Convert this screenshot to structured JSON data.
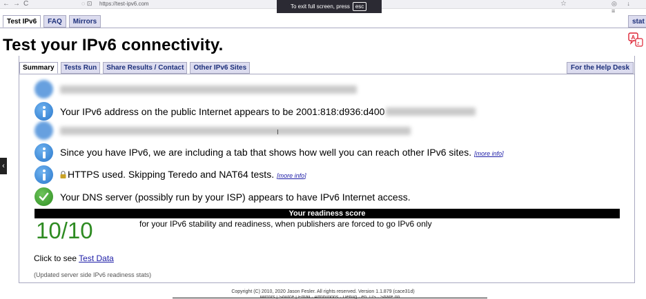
{
  "browser": {
    "url": "https://test-ipv6.com",
    "nav_glyphs": "←→C",
    "url_icons": "◌ ⊡",
    "star_glyph": "☆",
    "right_glyphs": "◎ ↓ ≡"
  },
  "fullscreen_toast": {
    "text": "To exit full screen, press",
    "key": "esc"
  },
  "top_tabs": [
    {
      "label": "Test IPv6",
      "active": true
    },
    {
      "label": "FAQ",
      "active": false
    },
    {
      "label": "Mirrors",
      "active": false
    }
  ],
  "top_tab_right": "stat",
  "page_title": "Test your IPv6 connectivity.",
  "sub_tabs": [
    {
      "label": "Summary",
      "active": true
    },
    {
      "label": "Tests Run",
      "active": false
    },
    {
      "label": "Share Results / Contact",
      "active": false
    },
    {
      "label": "Other IPv6 Sites",
      "active": false
    }
  ],
  "sub_tab_right": "For the Help Desk",
  "results": {
    "ipv6_address": "Your IPv6 address on the public Internet appears to be 2001:818:d936:d400",
    "other_sites": "Since you have IPv6, we are including a tab that shows how well you can reach other IPv6 sites.",
    "https": "HTTPS used. Skipping Teredo and NAT64 tests.",
    "dns": "Your DNS server (possibly run by your ISP) appears to have IPv6 Internet access.",
    "more_info": "[more info]"
  },
  "readiness": {
    "bar_label": "Your readiness score",
    "score": "10/10",
    "description": "for your IPv6 stability and readiness, when publishers are forced to go IPv6 only"
  },
  "test_data": {
    "prefix": "Click to see",
    "link": "Test Data"
  },
  "updated_note": "(Updated server side IPv6 readiness stats)",
  "footer": {
    "copyright": "Copyright (C) 2010, 2020 Jason Fesler. All rights reserved. Version 1.1.879 (cace31d)",
    "links": "Mirrors | Source | Email · Attributions · Debug · en_US · Share on"
  },
  "side_arrow": "‹",
  "colors": {
    "tab_bg": "#dcdcef",
    "tab_text": "#1c2f7a",
    "info_blue": "#2a78cc",
    "ok_green": "#2e8f22",
    "score_green": "#2e8b22",
    "link": "#1a1aa6"
  }
}
